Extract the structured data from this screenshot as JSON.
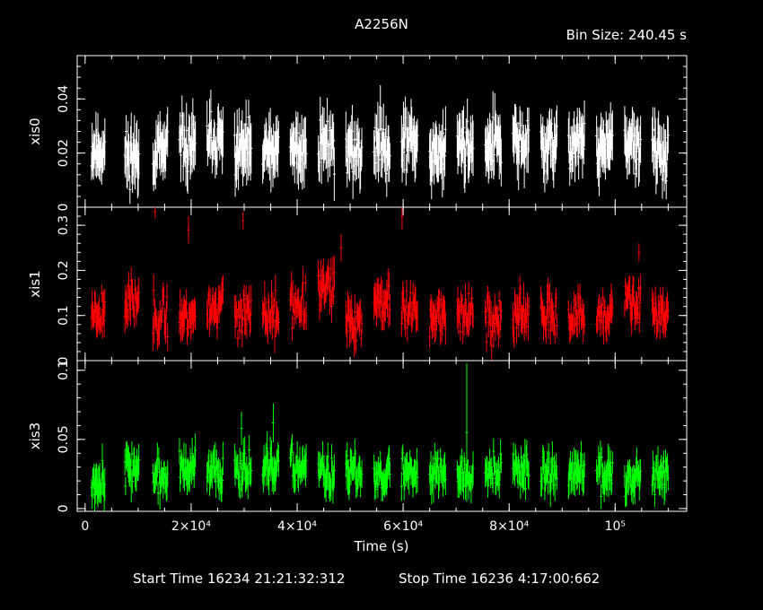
{
  "chart_data": {
    "type": "scatter",
    "title": "A2256N",
    "bin_size_text": "Bin Size: 240.45 s",
    "xlabel": "Time (s)",
    "xlim": [
      -1500,
      113500
    ],
    "x_ticks": [
      {
        "value": 0,
        "label": "0"
      },
      {
        "value": 20000,
        "label": "2×10⁴"
      },
      {
        "value": 40000,
        "label": "4×10⁴"
      },
      {
        "value": 60000,
        "label": "6×10⁴"
      },
      {
        "value": 80000,
        "label": "8×10⁴"
      },
      {
        "value": 100000,
        "label": "10⁵"
      }
    ],
    "footer": {
      "start": "Start Time 16234 21:21:32:312",
      "stop": "Stop Time 16236  4:17:00:662"
    },
    "segments": [
      [
        1200,
        3800
      ],
      [
        7500,
        10200
      ],
      [
        12800,
        15600
      ],
      [
        17800,
        20800
      ],
      [
        23000,
        26000
      ],
      [
        28200,
        31400
      ],
      [
        33500,
        36600
      ],
      [
        38700,
        41800
      ],
      [
        44000,
        47000
      ],
      [
        49200,
        52300
      ],
      [
        54500,
        57500
      ],
      [
        59700,
        62800
      ],
      [
        65000,
        68000
      ],
      [
        70200,
        73300
      ],
      [
        75500,
        78500
      ],
      [
        80700,
        83700
      ],
      [
        86000,
        89000
      ],
      [
        91200,
        94300
      ],
      [
        96500,
        99500
      ],
      [
        101800,
        104800
      ],
      [
        107000,
        110000
      ]
    ],
    "panels": [
      {
        "name": "xis0",
        "ylabel": "xis0",
        "color": "#ffffff",
        "ylim": [
          0,
          0.056
        ],
        "y_ticks": [
          {
            "value": 0,
            "label": "0"
          },
          {
            "value": 0.02,
            "label": "0.02"
          },
          {
            "value": 0.04,
            "label": "0.04"
          }
        ],
        "segment_levels": [
          0.021,
          0.019,
          0.02,
          0.022,
          0.024,
          0.021,
          0.02,
          0.021,
          0.024,
          0.02,
          0.024,
          0.024,
          0.021,
          0.023,
          0.024,
          0.023,
          0.022,
          0.024,
          0.022,
          0.023,
          0.02
        ],
        "noise": 0.007,
        "err": 0.008,
        "seed": 11,
        "spikes": []
      },
      {
        "name": "xis1",
        "ylabel": "xis1",
        "color": "#ff0000",
        "ylim": [
          0,
          0.34
        ],
        "y_ticks": [
          {
            "value": 0,
            "label": "0"
          },
          {
            "value": 0.1,
            "label": "0.1"
          },
          {
            "value": 0.2,
            "label": "0.2"
          },
          {
            "value": 0.3,
            "label": "0.3"
          }
        ],
        "segment_levels": [
          0.11,
          0.13,
          0.1,
          0.1,
          0.12,
          0.1,
          0.1,
          0.12,
          0.16,
          0.09,
          0.13,
          0.11,
          0.1,
          0.11,
          0.09,
          0.1,
          0.1,
          0.09,
          0.1,
          0.13,
          0.11
        ],
        "noise": 0.035,
        "err": 0.03,
        "seed": 23,
        "spikes": [
          {
            "x": 13200,
            "y": 0.33,
            "err": 0.015
          },
          {
            "x": 19500,
            "y": 0.29,
            "err": 0.03
          },
          {
            "x": 29800,
            "y": 0.31,
            "err": 0.02
          },
          {
            "x": 59800,
            "y": 0.32,
            "err": 0.03
          },
          {
            "x": 48300,
            "y": 0.25,
            "err": 0.03
          },
          {
            "x": 104500,
            "y": 0.24,
            "err": 0.02
          }
        ]
      },
      {
        "name": "xis3",
        "ylabel": "xis3",
        "color": "#00ff00",
        "ylim": [
          -0.002,
          0.107
        ],
        "y_ticks": [
          {
            "value": 0,
            "label": "0"
          },
          {
            "value": 0.05,
            "label": "0.05"
          },
          {
            "value": 0.1,
            "label": "0.1"
          }
        ],
        "segment_levels": [
          0.021,
          0.03,
          0.022,
          0.028,
          0.026,
          0.03,
          0.028,
          0.03,
          0.025,
          0.024,
          0.025,
          0.027,
          0.026,
          0.026,
          0.028,
          0.027,
          0.025,
          0.026,
          0.025,
          0.024,
          0.024
        ],
        "noise": 0.01,
        "err": 0.01,
        "seed": 37,
        "spikes": [
          {
            "x": 72000,
            "y": 0.055,
            "err": 0.05
          },
          {
            "x": 35500,
            "y": 0.062,
            "err": 0.014
          },
          {
            "x": 29500,
            "y": 0.058,
            "err": 0.012
          }
        ]
      }
    ]
  }
}
